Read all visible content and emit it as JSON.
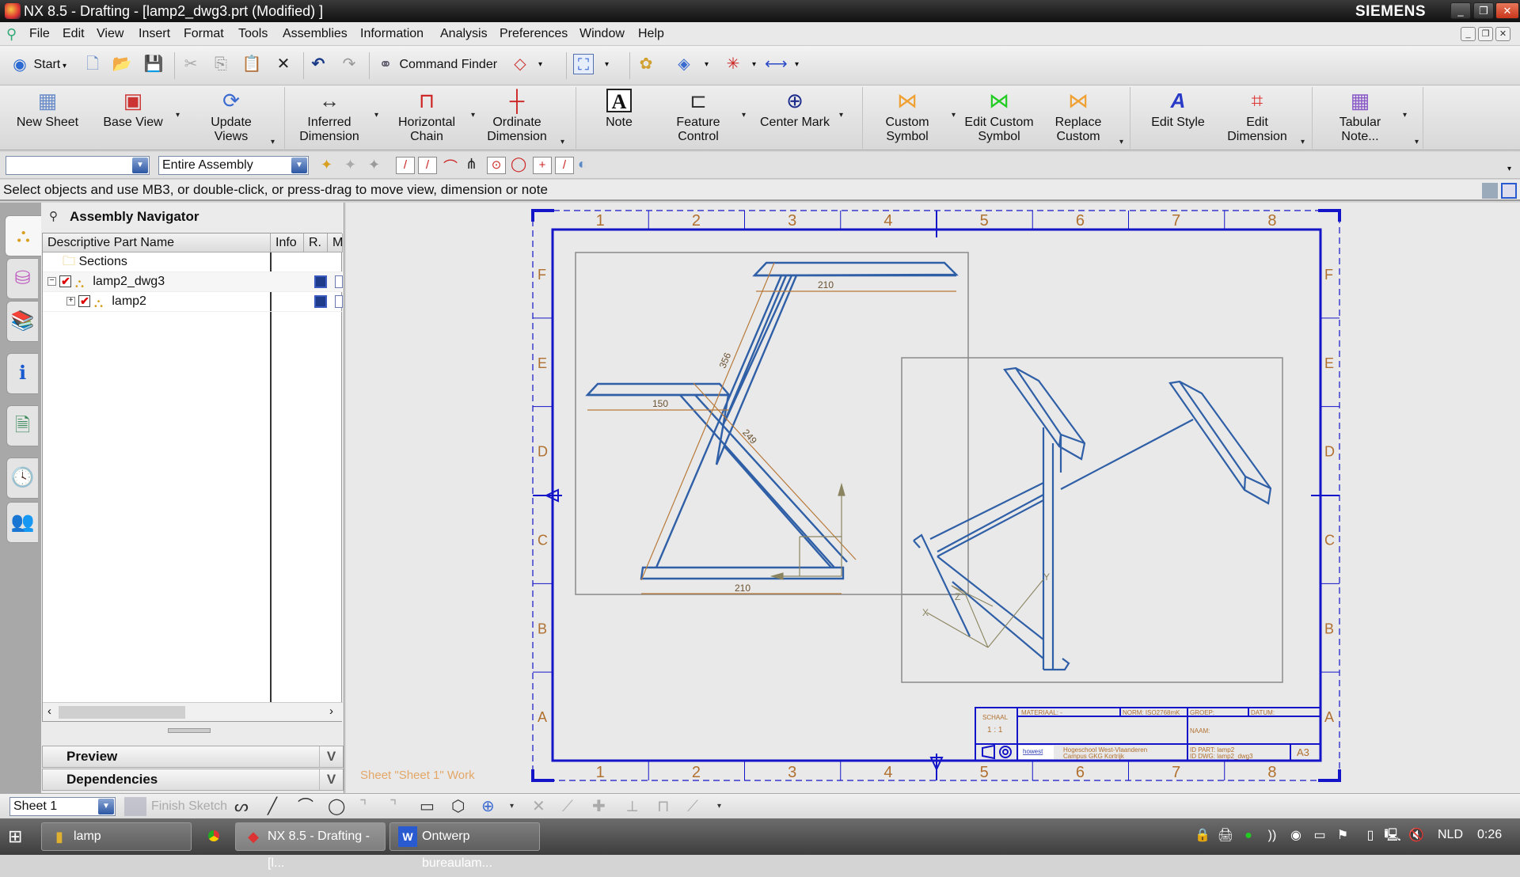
{
  "window": {
    "title": "NX 8.5 - Drafting - [lamp2_dwg3.prt (Modified) ]",
    "brand": "SIEMENS"
  },
  "menu": [
    "File",
    "Edit",
    "View",
    "Insert",
    "Format",
    "Tools",
    "Assemblies",
    "Information",
    "Analysis",
    "Preferences",
    "Window",
    "Help"
  ],
  "toolbar": {
    "start_label": "Start",
    "command_finder_label": "Command Finder"
  },
  "ribbon": [
    {
      "label1": "New Sheet",
      "label2": ""
    },
    {
      "label1": "Base View",
      "label2": ""
    },
    {
      "label1": "Update",
      "label2": "Views"
    },
    {
      "label1": "Inferred",
      "label2": "Dimension"
    },
    {
      "label1": "Horizontal",
      "label2": "Chain"
    },
    {
      "label1": "Ordinate",
      "label2": "Dimension"
    },
    {
      "label1": "Note",
      "label2": ""
    },
    {
      "label1": "Feature",
      "label2": "Control"
    },
    {
      "label1": "Center Mark",
      "label2": ""
    },
    {
      "label1": "Custom",
      "label2": "Symbol"
    },
    {
      "label1": "Edit Custom",
      "label2": "Symbol"
    },
    {
      "label1": "Replace",
      "label2": "Custom"
    },
    {
      "label1": "Edit Style",
      "label2": ""
    },
    {
      "label1": "Edit",
      "label2": "Dimension"
    },
    {
      "label1": "Tabular",
      "label2": "Note..."
    }
  ],
  "selection_bar": {
    "type_filter_value": "",
    "scope_value": "Entire Assembly"
  },
  "prompt": "Select objects and use MB3, or double-click, or press-drag to move view, dimension or note",
  "navigator": {
    "title": "Assembly Navigator",
    "columns": [
      "Descriptive Part Name",
      "Info",
      "R.",
      "M"
    ],
    "rows": [
      {
        "name": "Sections",
        "type": "folder",
        "checked": false
      },
      {
        "name": "lamp2_dwg3",
        "type": "assembly",
        "checked": true,
        "expand": "−"
      },
      {
        "name": "lamp2",
        "type": "assembly",
        "checked": true,
        "expand": "+"
      }
    ],
    "preview_label": "Preview",
    "dependencies_label": "Dependencies"
  },
  "drawing": {
    "sheet_status": "Sheet \"Sheet 1\" Work",
    "col_labels": [
      "1",
      "2",
      "3",
      "4",
      "5",
      "6",
      "7",
      "8"
    ],
    "row_labels": [
      "F",
      "E",
      "D",
      "C",
      "B",
      "A"
    ],
    "dimensions": {
      "top_width": "210",
      "left_shelf": "150",
      "diagonal_long": "356",
      "diagonal_short": "249",
      "base_width": "210"
    },
    "title_block": {
      "schaal_label": "SCHAAL",
      "schaal_value": "1 : 1",
      "materiaal": "MATERIAAL: -",
      "norm": "NORM: ISO2768mK",
      "groep": "GROEP:",
      "datum": "DATUM:",
      "naam": "NAAM:",
      "logo": "howest",
      "school_line1": "Hogeschool West-Vlaanderen",
      "school_line2": "Campus GKG Kortrijk",
      "id_part": "ID PART: lamp2",
      "id_dwg": "ID DWG: lamp2_dwg3",
      "format": "A3"
    }
  },
  "bottom_toolbar": {
    "sheet_value": "Sheet 1",
    "finish_sketch_label": "Finish Sketch"
  },
  "taskbar": {
    "items": [
      "lamp",
      "NX 8.5 - Drafting - [l...",
      "Ontwerp bureaulam..."
    ],
    "language": "NLD",
    "clock": "0:26"
  },
  "colors": {
    "geometry": "#2f5fa6",
    "dimension": "#b87a3a",
    "border": "#1414c8",
    "sheet_text": "#e3a768"
  }
}
